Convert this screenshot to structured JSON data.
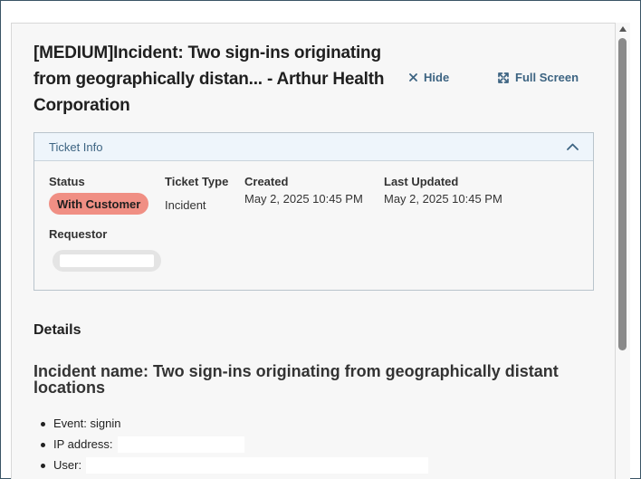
{
  "ticket": {
    "title": "[MEDIUM]Incident: Two sign-ins originating from geographically distan... - Arthur Health Corporation",
    "actions": {
      "hide_label": "Hide",
      "full_screen_label": "Full Screen"
    }
  },
  "ticket_info": {
    "section_title": "Ticket Info",
    "status_label": "Status",
    "status_value": "With Customer",
    "status_color": "#f08f84",
    "ticket_type_label": "Ticket Type",
    "ticket_type_value": "Incident",
    "created_label": "Created",
    "created_value": "May 2, 2025 10:45 PM",
    "last_updated_label": "Last Updated",
    "last_updated_value": "May 2, 2025 10:45 PM",
    "requestor_label": "Requestor"
  },
  "details": {
    "heading": "Details",
    "incident_heading": "Incident name: Two sign-ins originating from geographically distant locations",
    "items": [
      {
        "label": "Event: signin"
      },
      {
        "label": "IP address:"
      },
      {
        "label": "User:"
      }
    ]
  },
  "colors": {
    "accent": "#3d6482",
    "card_header_bg": "#eef5fb"
  },
  "icons": {
    "hide": "close-icon",
    "full_screen": "expand-icon",
    "collapse": "chevron-up-icon",
    "scroll_up": "arrow-up-icon"
  }
}
